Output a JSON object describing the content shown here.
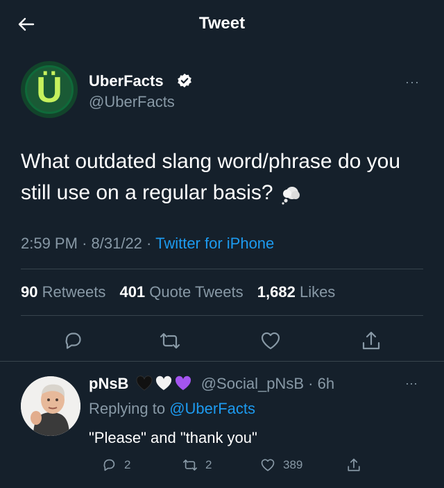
{
  "header": {
    "title": "Tweet",
    "back_icon": "arrow-left-icon"
  },
  "tweet": {
    "author_name": "UberFacts",
    "author_handle": "@UberFacts",
    "avatar_letter": "Ü",
    "verified": true,
    "text": "What outdated slang word/phrase do you still use on a regular basis?",
    "emoji": "thought-bubble-icon",
    "time": "2:59 PM",
    "date": "8/31/22",
    "source": "Twitter for iPhone",
    "more_label": "···"
  },
  "stats": {
    "retweets_count": "90",
    "retweets_label": "Retweets",
    "quotes_count": "401",
    "quotes_label": "Quote Tweets",
    "likes_count": "1,682",
    "likes_label": "Likes"
  },
  "reply": {
    "author_name": "pNsB",
    "hearts": [
      "black-heart",
      "white-heart",
      "purple-heart"
    ],
    "author_handle": "@Social_pNsB",
    "age": "6h",
    "replying_to_prefix": "Replying to",
    "replying_to_handle": "@UberFacts",
    "text": "\"Please\" and \"thank you\"",
    "reply_count": "2",
    "retweet_count": "2",
    "like_count": "389",
    "more_label": "···"
  },
  "colors": {
    "background": "#15202b",
    "accent": "#1d9bf0",
    "muted": "#8899a6",
    "divider": "#38444d"
  }
}
